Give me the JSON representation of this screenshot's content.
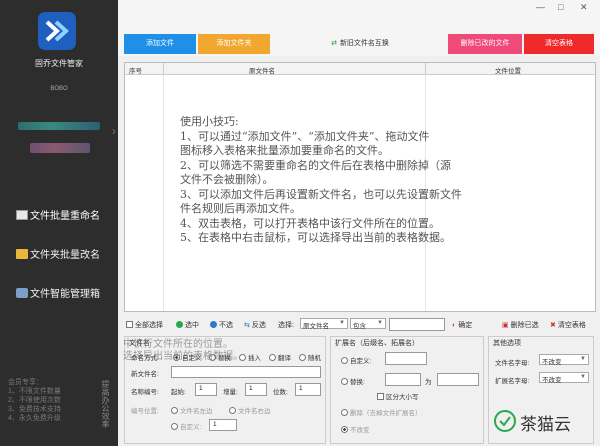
{
  "sidebar": {
    "app_name": "固乔文件管家",
    "user_name": "BOBO",
    "items": [
      {
        "label": "文件批量重命名"
      },
      {
        "label": "文件夹批量改名"
      },
      {
        "label": "文件智能管理箱"
      }
    ],
    "footer_lines": [
      "会员专享：",
      "1、不限文件数量",
      "2、不限使用次数",
      "3、免费技术支持",
      "4、永久免费升级"
    ],
    "vertical_text": "提高办公效率"
  },
  "window": {
    "minimize": "—",
    "maximize": "□",
    "close": "✕"
  },
  "toolbar": {
    "add_file": "添加文件",
    "add_folder": "添加文件夹",
    "swap_names": "新旧文件名互换",
    "delete_completed": "删除已改的文件",
    "clear_table": "清空表格"
  },
  "table": {
    "columns": [
      "序号",
      "原文件名",
      "文件位置"
    ],
    "tips": [
      "使用小技巧:",
      "1、可以通过“添加文件”、“添加文件夹”、拖动文件",
      "图标移入表格来批量添加要重命名的文件。",
      "2、可以筛选不需要重命名的文件后在表格中删除掉（源",
      "文件不会被删除）。",
      "3、可以添加文件后再设置新文件名，也可以先设置新文件",
      "件名规则后再添加文件。",
      "4、双击表格，可以打开表格中该行文件所在的位置。",
      "5、在表格中右击鼠标，可以选择导出当前的表格数据。"
    ]
  },
  "controls": {
    "select_all": "全部选择",
    "select": "选中",
    "deselect": "不选",
    "invert": "反选",
    "choose_label": "选择:",
    "choose_field": "原文件名",
    "choose_op": "包含",
    "choose_value": "",
    "confirm": "确定",
    "delete_selected": "删除已选",
    "clear_table": "清空表格"
  },
  "file_panel": {
    "title": "文件名",
    "mode_label": "命名方式:",
    "modes": [
      "自定义",
      "替换",
      "插入",
      "翻译",
      "随机"
    ],
    "new_name_label": "新文件名:",
    "new_name_value": "",
    "numbering_label": "名称编号:",
    "start_label": "起始:",
    "start_value": "1",
    "step_label": "增量:",
    "step_value": "1",
    "digits_label": "位数:",
    "digits_value": "1",
    "position_label": "编号位置:",
    "positions": [
      "文件名左边",
      "文件名右边"
    ],
    "custom_label": "自定义:",
    "custom_value": "1",
    "overlay_lines": [
      "中该行文件所在的位置。",
      "选择导出当前的表格数据。"
    ]
  },
  "ext_panel": {
    "title": "扩展名（后缀名、拓展名）",
    "custom": "自定义:",
    "replace": "替换:",
    "to": "为",
    "case_sensitive": "区分大小写",
    "delete_ext": "删除（去掉文件扩展名）",
    "unchanged": "不改变"
  },
  "other_panel": {
    "title": "其他选项",
    "filename_char_label": "文件名字母:",
    "filename_char_value": "不改变",
    "ext_char_label": "扩展名字母:",
    "ext_char_value": "不改变"
  },
  "watermark": "茶猫云",
  "colors": {
    "sidebar": "#2d2d2d",
    "add_file": "#1e90e8",
    "add_folder": "#f2a830",
    "delete_done": "#f04a78",
    "clear": "#f02a2a",
    "logo": "#1f5fbf"
  }
}
